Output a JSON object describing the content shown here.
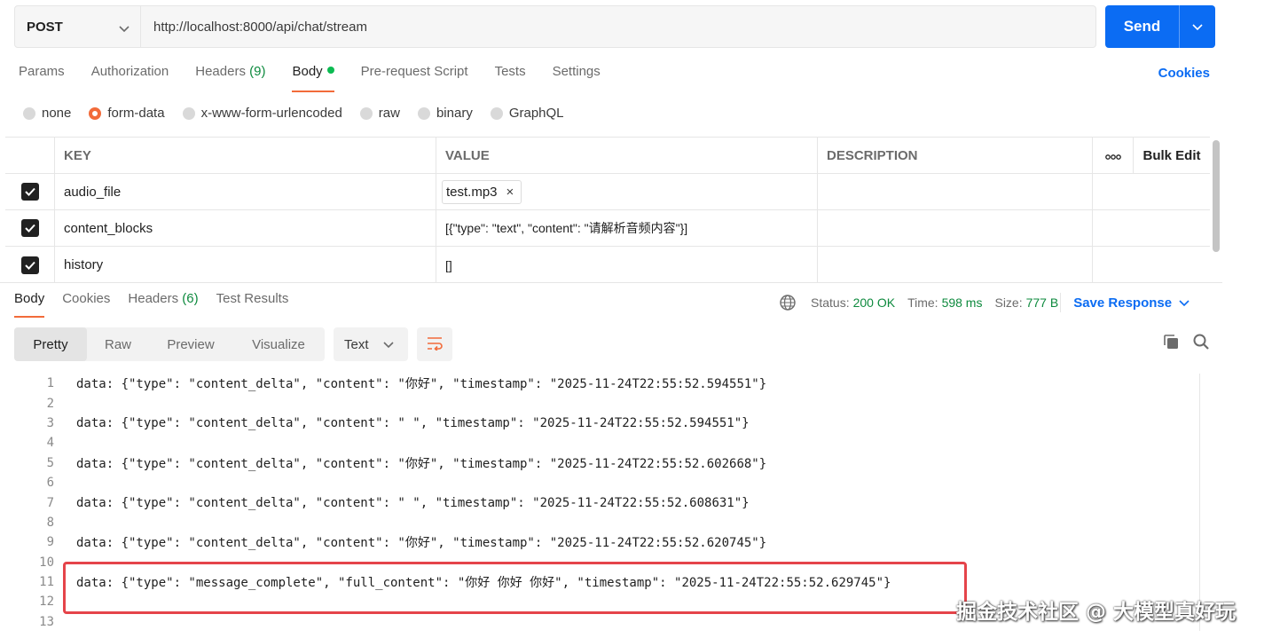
{
  "request": {
    "method": "POST",
    "url": "http://localhost:8000/api/chat/stream",
    "send_label": "Send"
  },
  "request_tabs": [
    {
      "label": "Params"
    },
    {
      "label": "Authorization"
    },
    {
      "label": "Headers",
      "count": "(9)"
    },
    {
      "label": "Body"
    },
    {
      "label": "Pre-request Script"
    },
    {
      "label": "Tests"
    },
    {
      "label": "Settings"
    }
  ],
  "cookies_label": "Cookies",
  "body_types": [
    {
      "label": "none"
    },
    {
      "label": "form-data"
    },
    {
      "label": "x-www-form-urlencoded"
    },
    {
      "label": "raw"
    },
    {
      "label": "binary"
    },
    {
      "label": "GraphQL"
    }
  ],
  "params_table": {
    "headers": {
      "key": "KEY",
      "value": "VALUE",
      "description": "DESCRIPTION",
      "more": "ooo",
      "bulk_edit": "Bulk Edit"
    },
    "rows": [
      {
        "key": "audio_file",
        "value": "test.mp3",
        "file_remove": "×"
      },
      {
        "key": "content_blocks",
        "value": "[{\"type\": \"text\", \"content\": \"请解析音频内容\"}]"
      },
      {
        "key": "history",
        "value": "[]"
      }
    ]
  },
  "response_tabs": [
    {
      "label": "Body"
    },
    {
      "label": "Cookies"
    },
    {
      "label": "Headers",
      "count": "(6)"
    },
    {
      "label": "Test Results"
    }
  ],
  "response_meta": {
    "status_label": "Status:",
    "status_value": "200 OK",
    "time_label": "Time:",
    "time_value": "598 ms",
    "size_label": "Size:",
    "size_value": "777 B",
    "save_label": "Save Response"
  },
  "view_modes": [
    {
      "label": "Pretty"
    },
    {
      "label": "Raw"
    },
    {
      "label": "Preview"
    },
    {
      "label": "Visualize"
    }
  ],
  "format_select": "Text",
  "code_lines": [
    {
      "n": "1",
      "text": "data: {\"type\": \"content_delta\", \"content\": \"你好\", \"timestamp\": \"2025-11-24T22:55:52.594551\"}"
    },
    {
      "n": "2",
      "text": ""
    },
    {
      "n": "3",
      "text": "data: {\"type\": \"content_delta\", \"content\": \" \", \"timestamp\": \"2025-11-24T22:55:52.594551\"}"
    },
    {
      "n": "4",
      "text": ""
    },
    {
      "n": "5",
      "text": "data: {\"type\": \"content_delta\", \"content\": \"你好\", \"timestamp\": \"2025-11-24T22:55:52.602668\"}"
    },
    {
      "n": "6",
      "text": ""
    },
    {
      "n": "7",
      "text": "data: {\"type\": \"content_delta\", \"content\": \" \", \"timestamp\": \"2025-11-24T22:55:52.608631\"}"
    },
    {
      "n": "8",
      "text": ""
    },
    {
      "n": "9",
      "text": "data: {\"type\": \"content_delta\", \"content\": \"你好\", \"timestamp\": \"2025-11-24T22:55:52.620745\"}"
    },
    {
      "n": "10",
      "text": ""
    },
    {
      "n": "11",
      "text": "data: {\"type\": \"message_complete\", \"full_content\": \"你好 你好 你好\", \"timestamp\": \"2025-11-24T22:55:52.629745\"}"
    },
    {
      "n": "12",
      "text": ""
    },
    {
      "n": "13",
      "text": ""
    }
  ],
  "watermark": "掘金技术社区 @ 大模型真好玩",
  "colors": {
    "accent_blue": "#0b6cf3",
    "active_tab_underline": "#f26b3a",
    "success_green": "#0e8a3e",
    "highlight_red": "#e5444a"
  }
}
